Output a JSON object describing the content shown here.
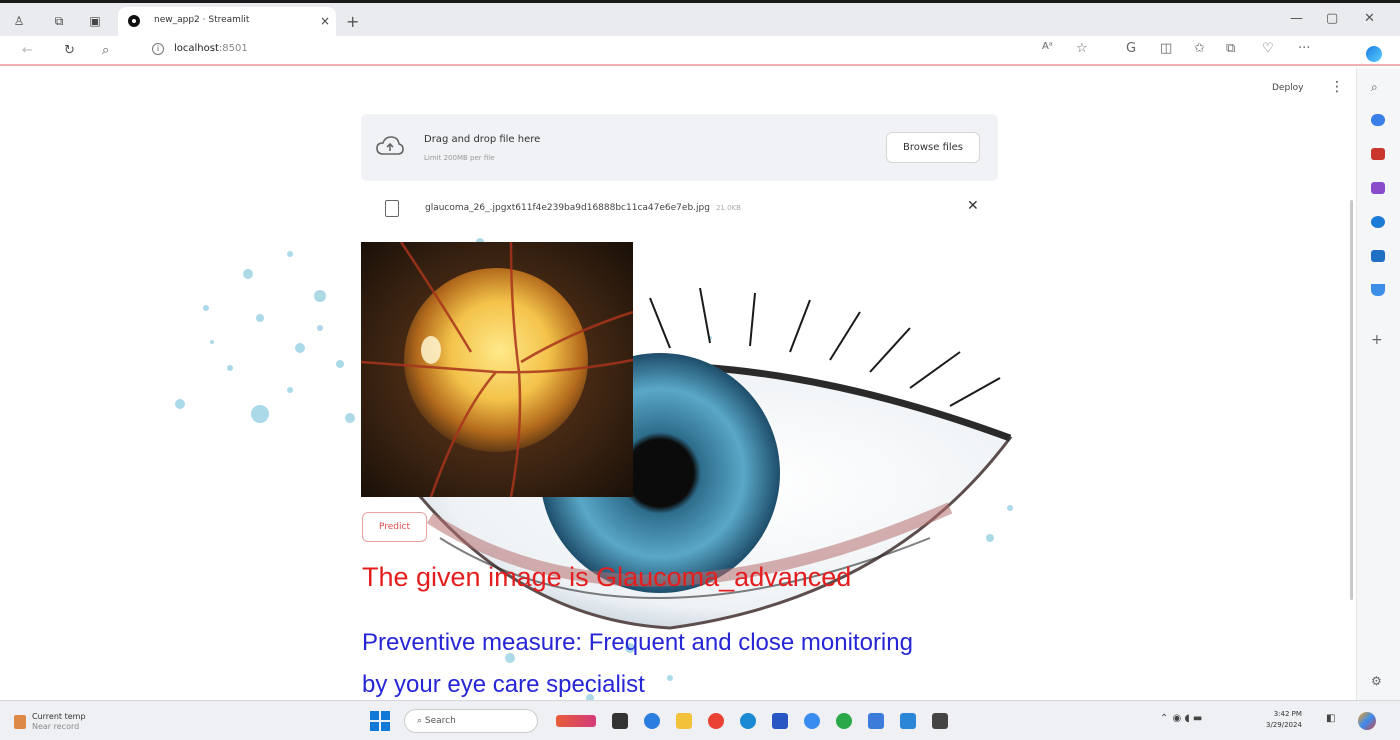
{
  "browser": {
    "tab_title": "new_app2 · Streamlit",
    "url_host": "localhost",
    "url_port": ":8501"
  },
  "app_header": {
    "deploy_label": "Deploy",
    "menu_icon": "kebab-menu-icon"
  },
  "uploader": {
    "drag_text": "Drag and drop file here",
    "limit_text": "Limit 200MB per file",
    "browse_label": "Browse files",
    "file_name": "glaucoma_26_.jpgxt611f4e239ba9d16888bc11ca47e6e7eb.jpg",
    "file_size": "21.0KB"
  },
  "predict_label": "Predict",
  "result_text": "The given image is Glaucoma_advanced",
  "preventive_text": "Preventive measure: Frequent and close monitoring by your eye care specialist",
  "taskbar": {
    "weather_title": "Current temp",
    "weather_sub": "Near record",
    "search_placeholder": "Search",
    "time": "3:42 PM",
    "date": "3/29/2024"
  },
  "colors": {
    "result": "#e41e1e",
    "preventive": "#2626d6",
    "predict_border": "#e9a0a0"
  }
}
